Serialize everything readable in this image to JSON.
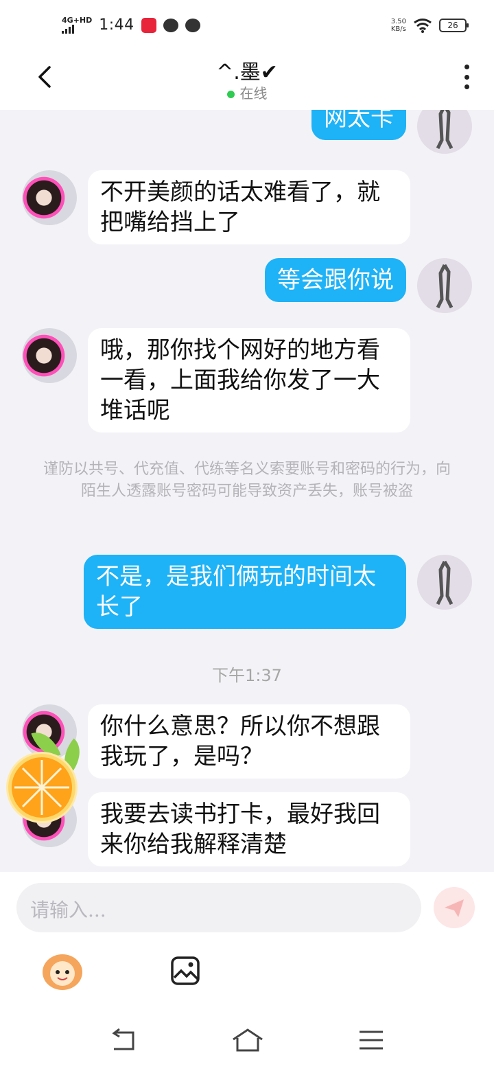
{
  "status": {
    "network": "4G+HD",
    "time": "1:44",
    "speed_value": "3.50",
    "speed_unit": "KB/s",
    "battery": "26"
  },
  "header": {
    "title": "^.墨✔",
    "status": "在线"
  },
  "messages": [
    {
      "side": "me",
      "text": "网太卡"
    },
    {
      "side": "peer",
      "text": "不开美颜的话太难看了，就把嘴给挡上了"
    },
    {
      "side": "me",
      "text": "等会跟你说"
    },
    {
      "side": "peer",
      "text": "哦，那你找个网好的地方看一看，上面我给你发了一大堆话呢"
    },
    {
      "side": "me",
      "text": "不是，是我们俩玩的时间太长了"
    },
    {
      "side": "peer",
      "text": "你什么意思？所以你不想跟我玩了，是吗？"
    },
    {
      "side": "peer",
      "text": "我要去读书打卡，最好我回来你给我解释清楚"
    }
  ],
  "notice": "谨防以共号、代充值、代练等名义索要账号和密码的行为，向陌生人透露账号密码可能导致资产丢失，账号被盗",
  "timestamp": "下午1:37",
  "input": {
    "placeholder": "请输入..."
  },
  "colors": {
    "my_bubble": "#1eb2f7",
    "peer_bubble": "#ffffff",
    "online_dot": "#2fcb52",
    "background": "#f3f3f7"
  }
}
